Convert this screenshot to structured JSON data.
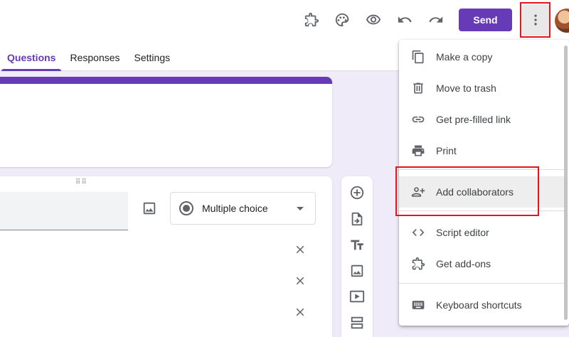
{
  "header": {
    "send_label": "Send",
    "icons": [
      "addon-puzzle-icon",
      "palette-icon",
      "preview-eye-icon",
      "undo-icon",
      "redo-icon",
      "more-vert-icon"
    ]
  },
  "tabs": [
    {
      "label": "Questions",
      "active": true
    },
    {
      "label": "Responses",
      "active": false
    },
    {
      "label": "Settings",
      "active": false
    }
  ],
  "question": {
    "type_label": "Multiple choice"
  },
  "menu": {
    "items": [
      {
        "label": "Make a copy",
        "icon": "copy-icon"
      },
      {
        "label": "Move to trash",
        "icon": "trash-icon"
      },
      {
        "label": "Get pre-filled link",
        "icon": "link-icon"
      },
      {
        "label": "Print",
        "icon": "print-icon"
      },
      {
        "label": "Add collaborators",
        "icon": "add-people-icon",
        "highlighted": true
      },
      {
        "label": "Script editor",
        "icon": "code-icon"
      },
      {
        "label": "Get add-ons",
        "icon": "addon-icon"
      },
      {
        "label": "Keyboard shortcuts",
        "icon": "keyboard-icon"
      }
    ]
  },
  "colors": {
    "accent": "#673ab7",
    "background": "#f0ebf8",
    "highlight_box": "#e8141a"
  }
}
